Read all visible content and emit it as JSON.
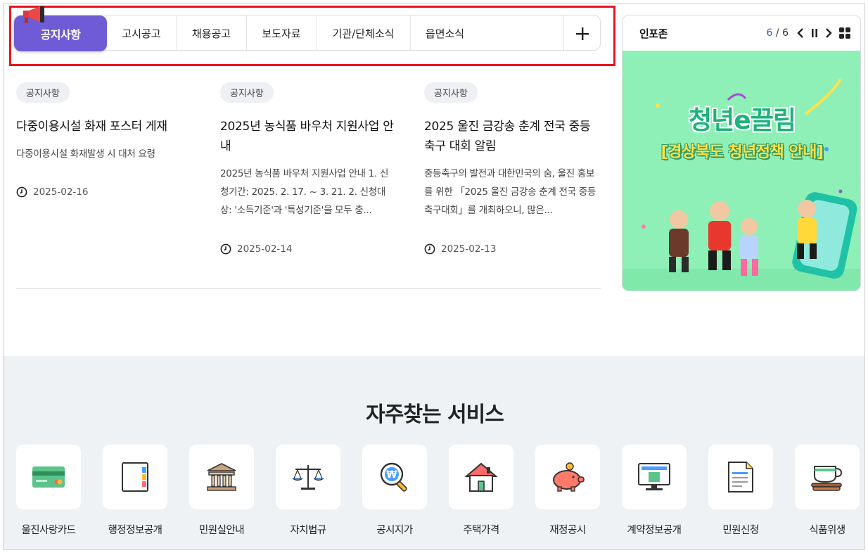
{
  "tabs": {
    "active": "공지사항",
    "items": [
      "고시공고",
      "채용공고",
      "보도자료",
      "기관/단체소식",
      "읍면소식"
    ],
    "more": "+"
  },
  "articles": [
    {
      "tag": "공지사항",
      "title": "다중이용시설 화재 포스터 게재",
      "desc": "다중이용시설 화재발생 시 대처 요령",
      "date": "2025-02-16"
    },
    {
      "tag": "공지사항",
      "title": "2025년 농식품 바우처 지원사업 안내",
      "desc": "2025년 농식품 바우처 지원사업 안내 1. 신청기간: 2025. 2. 17. ~ 3. 21. 2. 신청대상: '소득기준'과 '특성기준'을 모두 충...",
      "date": "2025-02-14"
    },
    {
      "tag": "공지사항",
      "title": "2025 울진 금강송 춘계 전국 중등 축구 대회 알림",
      "desc": "중등축구의 발전과 대한민국의 숨, 울진 홍보를 위한 「2025 울진 금강송 춘계 전국 중등 축구대회」를 개최하오니, 많은...",
      "date": "2025-02-13"
    }
  ],
  "infozone": {
    "title": "인포존",
    "current": "6",
    "total": "6",
    "banner_title": "청년e끌림",
    "banner_sub": "[경상북도 청년정책 안내]"
  },
  "services": {
    "title": "자주찾는 서비스",
    "items": [
      {
        "label": "울진사랑카드",
        "icon": "card-icon"
      },
      {
        "label": "행정정보공개",
        "icon": "binder-icon"
      },
      {
        "label": "민원실안내",
        "icon": "building-icon"
      },
      {
        "label": "자치법규",
        "icon": "scale-icon"
      },
      {
        "label": "공시지가",
        "icon": "magnifier-won-icon"
      },
      {
        "label": "주택가격",
        "icon": "house-icon"
      },
      {
        "label": "재정공시",
        "icon": "piggy-bank-icon"
      },
      {
        "label": "계약정보공개",
        "icon": "monitor-icon"
      },
      {
        "label": "민원신청",
        "icon": "document-icon"
      },
      {
        "label": "식품위생",
        "icon": "teacup-icon"
      }
    ]
  },
  "colors": {
    "accent": "#6f5bd6",
    "highlight": "#e8141c",
    "banner_bg": "#8ef0b6",
    "services_bg": "#eff2f5"
  }
}
